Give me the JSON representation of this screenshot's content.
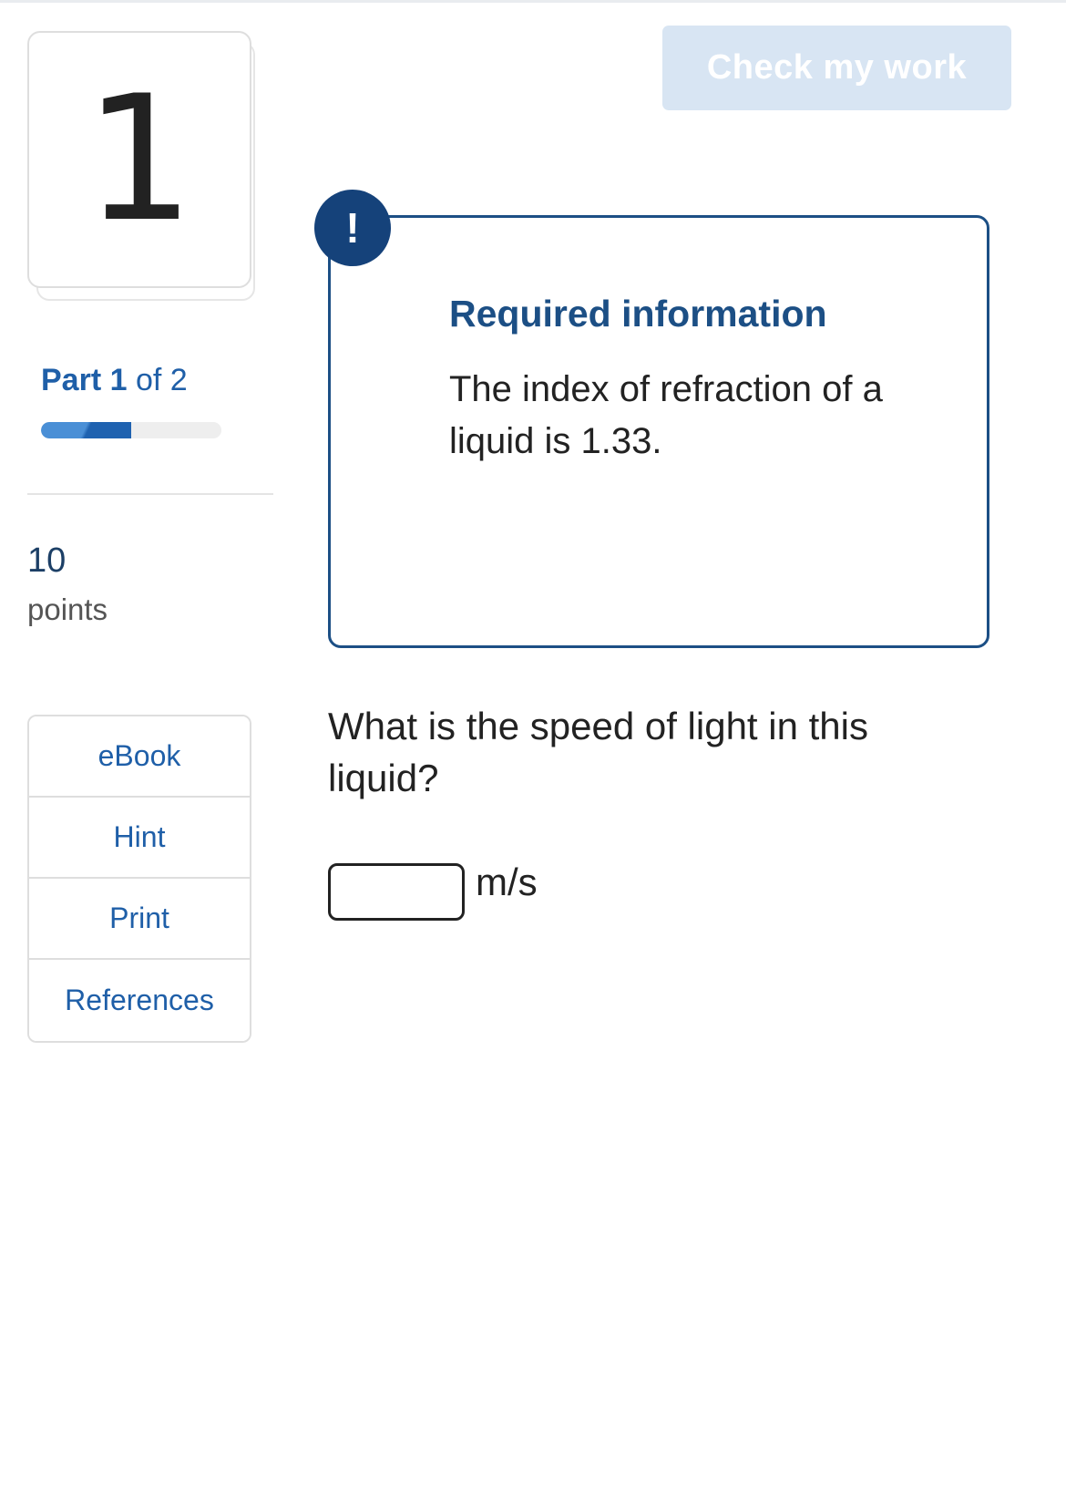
{
  "question": {
    "number": "1",
    "part_label": "Part",
    "part_current": "1",
    "part_of": "of 2",
    "part_progress": 0.5,
    "points_value": "10",
    "points_label": "points",
    "prompt": "What is the speed of light in this liquid?",
    "answer_value": "",
    "answer_placeholder": "",
    "unit": "m/s"
  },
  "tools": [
    {
      "label": "eBook"
    },
    {
      "label": "Hint"
    },
    {
      "label": "Print"
    },
    {
      "label": "References"
    }
  ],
  "actions": {
    "check_label": "Check my work"
  },
  "required_info": {
    "badge_symbol": "!",
    "title": "Required information",
    "text": "The index of refraction of a liquid is 1.33."
  },
  "colors": {
    "accent": "#1f5fa8",
    "info_border": "#1c4f85",
    "badge": "#15427a",
    "check_button_disabled": "#d8e5f3"
  },
  "icons": {
    "badge": "exclamation-icon"
  }
}
